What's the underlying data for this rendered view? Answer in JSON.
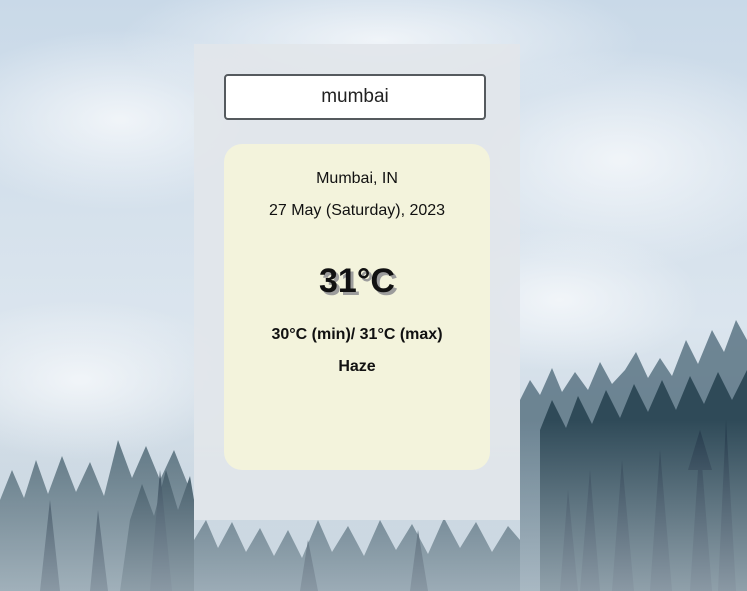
{
  "search": {
    "value": "mumbai"
  },
  "weather": {
    "location": "Mumbai, IN",
    "date": "27 May (Saturday), 2023",
    "temperature": "31°C",
    "min_max": "30°C (min)/ 31°C (max)",
    "condition": "Haze"
  },
  "colors": {
    "card_background": "#e2e6ea",
    "panel_background": "#f3f3dc",
    "input_border": "#555a5e"
  }
}
